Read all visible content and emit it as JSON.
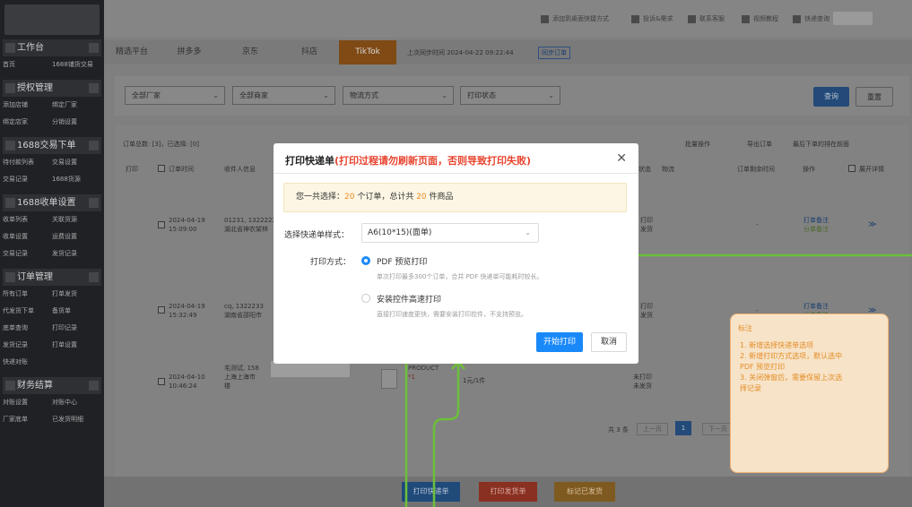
{
  "sidebar": {
    "sections": [
      {
        "label": "工作台",
        "items": [
          [
            "首页",
            "1688铺货交易"
          ]
        ]
      },
      {
        "label": "授权管理",
        "items": [
          [
            "添加店铺",
            "绑定厂家"
          ],
          [
            "绑定店家",
            "分销设置"
          ]
        ]
      },
      {
        "label": "1688交易下单",
        "items": [
          [
            "待付款列表",
            "交易设置"
          ],
          [
            "交易记录",
            "1688货源"
          ]
        ]
      },
      {
        "label": "1688收单设置",
        "items": [
          [
            "收单列表",
            "关联货源"
          ],
          [
            "收单设置",
            "运费设置"
          ],
          [
            "交易记录",
            "发货记录"
          ]
        ]
      },
      {
        "label": "订单管理",
        "items": [
          [
            "所有订单",
            "打单发货"
          ],
          [
            "代发货下单",
            "备货单"
          ],
          [
            "底单查询",
            "打印记录"
          ],
          [
            "发货记录",
            "打单设置"
          ],
          [
            "快递对账",
            ""
          ]
        ]
      },
      {
        "label": "财务结算",
        "items": [
          [
            "对账设置",
            "对账中心"
          ],
          [
            "厂家底单",
            "已发货明细"
          ]
        ]
      }
    ]
  },
  "topbar": {
    "quick_links": [
      "添加到桌面快捷方式",
      "投诉&需求",
      "联系客服",
      "视频教程",
      "快递查询"
    ]
  },
  "platform_tabs": {
    "items": [
      "精选平台",
      "拼多多",
      "京东",
      "抖店",
      "TikTok"
    ],
    "active_index": 4,
    "sync_time_label": "上次同步时间 2024-04-22 09:22:44",
    "sync_button": "同步订单"
  },
  "filters": {
    "factory": "全部厂家",
    "merchant": "全部商家",
    "logistics": "物流方式",
    "print_status": "打印状态",
    "query_button": "查询",
    "reset_button": "重置"
  },
  "table": {
    "summary": "订单总数: [3]，已选择: [0]",
    "toolbar": [
      "批量操作",
      "导出订单",
      "最后下单的排在前面"
    ],
    "columns": [
      "打印",
      "订单时间",
      "收件人信息",
      "状态",
      "物流",
      "订单剩余时间",
      "操作",
      "展开详情"
    ],
    "rows": [
      {
        "date": "2024-04-19",
        "time": "15:09:00",
        "receiver": "01231, 1322222",
        "address": "湖北省神农架林",
        "status": "打印",
        "status2": "发货",
        "ops": [
          "打单备注",
          "分单备注"
        ],
        "remaining": "-"
      },
      {
        "date": "2024-04-19",
        "time": "15:32:49",
        "receiver": "cq, 1322233",
        "address": "湖南省邵阳市",
        "status": "打印",
        "status2": "发货",
        "ops": [
          "打单备注",
          "分单备注"
        ],
        "remaining": "-"
      },
      {
        "date": "2024-04-10",
        "time": "10:46:24",
        "receiver": "毛测试, 158",
        "address": "上海上海市",
        "address2": "楼",
        "product": "PRODUCT",
        "qty": "*1",
        "price": "1元/1件",
        "status": "未打印",
        "status2": "未发货",
        "remaining": "-"
      }
    ],
    "pagination": {
      "total": "共 3 条",
      "prev": "上一页",
      "page": "1",
      "next": "下一页"
    }
  },
  "bottom_actions": [
    "打印快递单",
    "打印发货单",
    "标记已发货"
  ],
  "modal": {
    "title": "打印快递单",
    "title_warning": "(打印过程请勿刷新页面，否则导致打印失败)",
    "summary_prefix": "您一共选择：",
    "selected_orders": "20",
    "summary_mid": " 个订单，总计共 ",
    "selected_items": "20",
    "summary_suffix": " 件商品",
    "style_label": "选择快递单样式：",
    "style_value": "A6(10*15)(面单)",
    "method_label": "打印方式：",
    "options": [
      {
        "label": "PDF 预览打印",
        "desc": "单次打印最多300个订单，合并 PDF 快递单可能耗时较长。",
        "selected": true
      },
      {
        "label": "安装控件高速打印",
        "desc": "直接打印速度更快，需要安装打印控件，不支持预览。",
        "selected": false
      }
    ],
    "start_button": "开始打印",
    "cancel_button": "取消"
  },
  "annotation": {
    "title": "标注",
    "items": [
      "1. 新增选择快递单选项",
      "2. 新增打印方式选项，默认选中",
      "   PDF 预览打印",
      "3. 关闭弹窗后，需要保留上次选",
      "   择记录"
    ]
  },
  "colors": {
    "accent": "#1989fa",
    "warning": "#e8442e",
    "annotation": "#e38c24",
    "connector": "#6cbf3a"
  }
}
